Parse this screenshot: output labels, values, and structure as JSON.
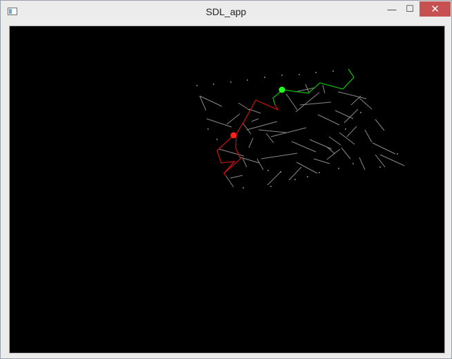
{
  "window": {
    "title": "SDL_app",
    "minimize_glyph": "—",
    "maximize_glyph": "☐",
    "close_glyph": "✕"
  },
  "icons": {
    "app": "app-window-icon",
    "minimize": "minimize-icon",
    "maximize": "maximize-icon",
    "close": "close-icon"
  },
  "colors": {
    "background": "#000000",
    "maze_lines": "#8a8a8a",
    "red_path": "#d01010",
    "green_path": "#10c010",
    "red_agent": "#ff2020",
    "green_agent": "#20ff20",
    "close_button": "#c75050"
  }
}
